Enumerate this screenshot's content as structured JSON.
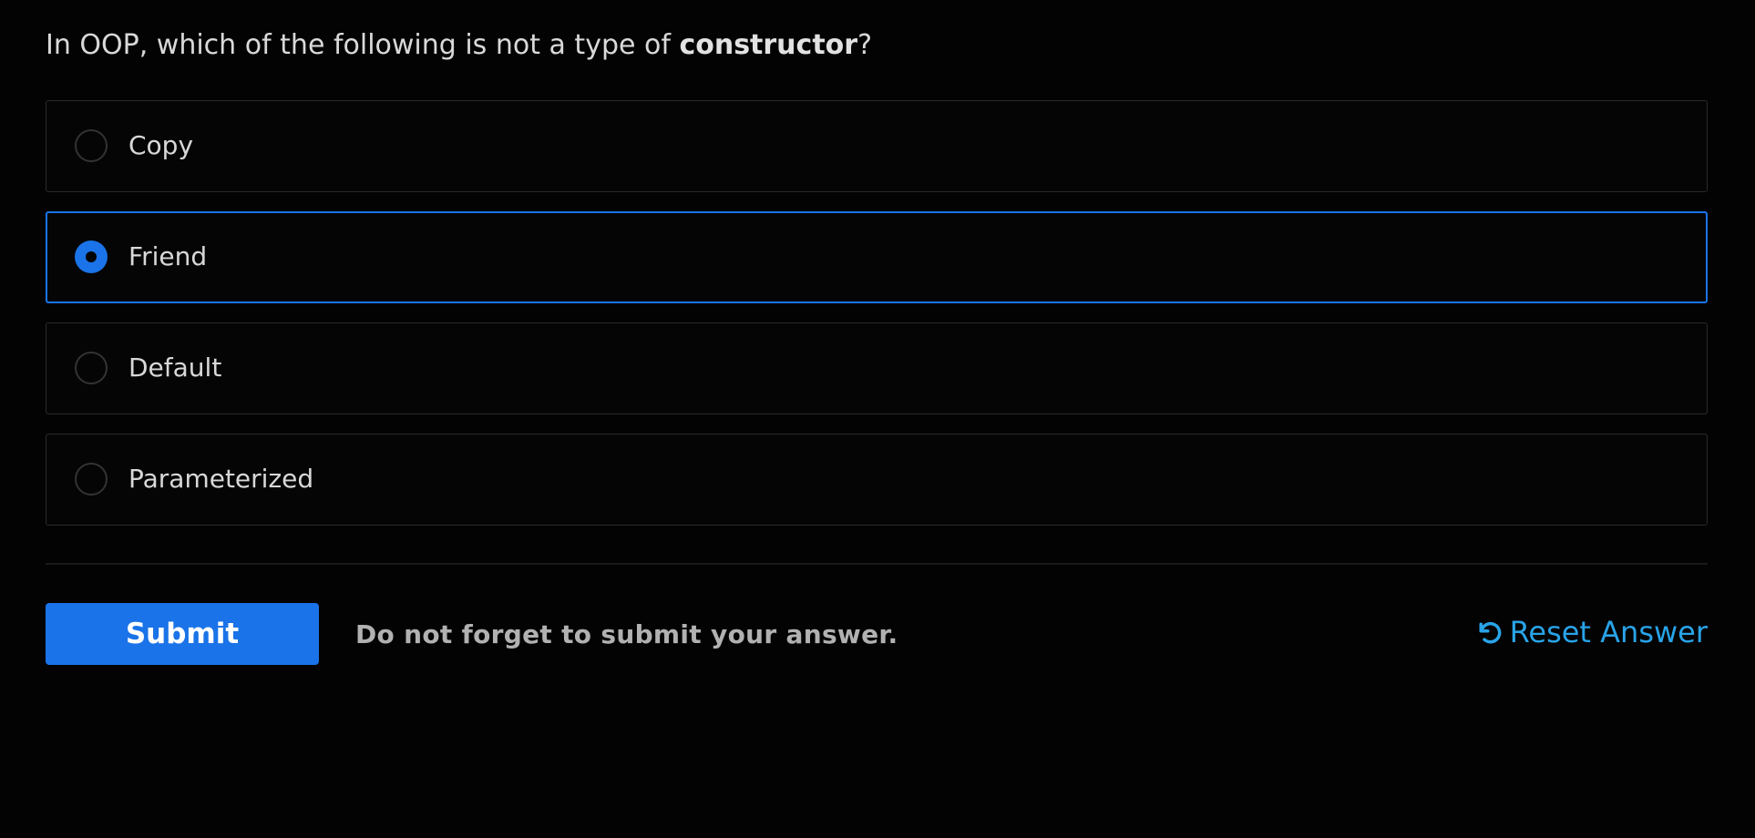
{
  "question": {
    "prefix": "In OOP, which of the following is not a type of ",
    "emphasis": "constructor",
    "suffix": "?"
  },
  "options": [
    {
      "label": "Copy",
      "selected": false
    },
    {
      "label": "Friend",
      "selected": true
    },
    {
      "label": "Default",
      "selected": false
    },
    {
      "label": "Parameterized",
      "selected": false
    }
  ],
  "actions": {
    "submit_label": "Submit",
    "hint": "Do not forget to submit your answer.",
    "reset_label": "Reset Answer",
    "reset_icon": "reset-icon"
  },
  "colors": {
    "accent": "#1a73e8",
    "link": "#29a3e8",
    "background": "#030303"
  }
}
